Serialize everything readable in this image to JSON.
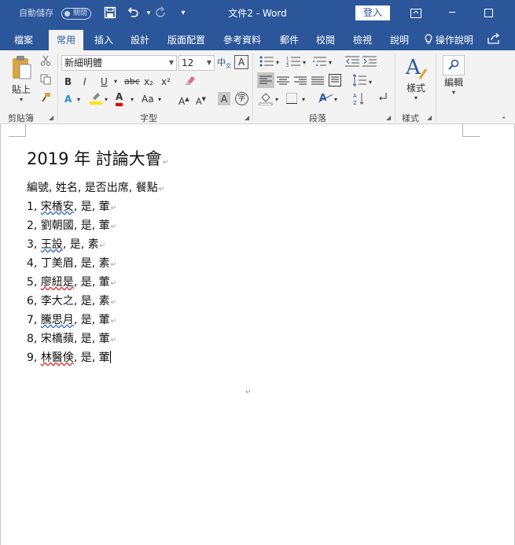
{
  "titlebar": {
    "autosave_label": "自動儲存",
    "autosave_toggle": "關閉",
    "doc_title": "文件2  -  Word",
    "signin_label": "登入",
    "icons": [
      "save-icon",
      "undo-icon",
      "redo-icon",
      "customize-icon",
      "ribbon-display-icon",
      "minimize-icon",
      "maximize-icon"
    ]
  },
  "tabs": [
    {
      "label": "檔案"
    },
    {
      "label": "常用"
    },
    {
      "label": "插入"
    },
    {
      "label": "設計"
    },
    {
      "label": "版面配置"
    },
    {
      "label": "參考資料"
    },
    {
      "label": "郵件"
    },
    {
      "label": "校閱"
    },
    {
      "label": "檢視"
    },
    {
      "label": "說明"
    }
  ],
  "tell_me": "操作說明",
  "ribbon": {
    "clipboard": {
      "paste_label": "貼上",
      "group_label": "剪貼簿"
    },
    "font": {
      "font_name": "新細明體",
      "font_size": "12",
      "group_label": "字型",
      "bold": "B",
      "italic": "I",
      "underline": "U",
      "strike": "abc",
      "sub": "x₂",
      "sup": "x²",
      "font_color": "A",
      "change_case": "Aa",
      "grow": "A",
      "shrink": "A",
      "char_shade": "A",
      "phonetic": "字"
    },
    "paragraph": {
      "group_label": "段落"
    },
    "styles": {
      "button_label": "樣式",
      "group_label": "樣式"
    },
    "editing": {
      "button_label": "編輯"
    }
  },
  "document": {
    "heading": "2019  年  討論大會",
    "header_row": "編號, 姓名, 是否出席, 餐點",
    "rows": [
      {
        "num": "1,",
        "name": "宋楿安",
        "rest": ",  是,  葷"
      },
      {
        "num": "2,",
        "name": "劉朝國",
        "rest": ",  是,  葷"
      },
      {
        "num": "3,",
        "name": "王設",
        "rest": ",  是,  素"
      },
      {
        "num": "4,",
        "name": "丁美眉",
        "rest": ",  是,  素"
      },
      {
        "num": "5,",
        "name": "廖紐是",
        "rest": ",  是,  葷"
      },
      {
        "num": "6,",
        "name": "李大之",
        "rest": ",  是,  素"
      },
      {
        "num": "7,",
        "name": "騰思月",
        "rest": ",  是,  葷"
      },
      {
        "num": "8,",
        "name": "宋橋蘋",
        "rest": ",  是,  葷"
      },
      {
        "num": "9,",
        "name": "林醫倹",
        "rest": ",  是,  葷"
      }
    ],
    "paragraph_mark": "↵"
  }
}
